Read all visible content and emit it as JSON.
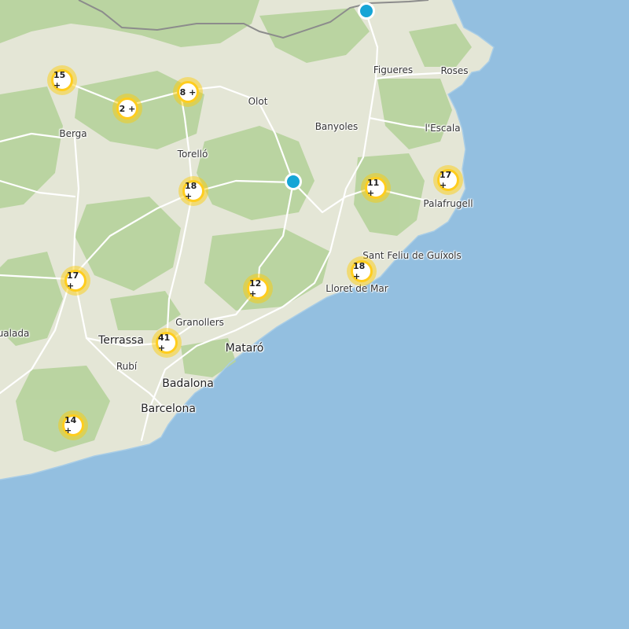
{
  "map": {
    "colors": {
      "sea": "#93bfe0",
      "land": "#e4e6d6",
      "forest": "#b6d39c",
      "road": "#ffffff",
      "border": "#8c8c8c",
      "cluster": "#ffcd1e",
      "marker": "#16a5d6"
    },
    "places": [
      {
        "id": "figueres",
        "name": "Figueres",
        "size": "med"
      },
      {
        "id": "roses",
        "name": "Roses",
        "size": "med"
      },
      {
        "id": "olot",
        "name": "Olot",
        "size": "med"
      },
      {
        "id": "banyoles",
        "name": "Banyoles",
        "size": "med"
      },
      {
        "id": "lescala",
        "name": "l'Escala",
        "size": "med"
      },
      {
        "id": "berga",
        "name": "Berga",
        "size": "med"
      },
      {
        "id": "torello",
        "name": "Torelló",
        "size": "med"
      },
      {
        "id": "palafrugell",
        "name": "Palafrugell",
        "size": "med"
      },
      {
        "id": "santfeliu",
        "name": "Sant Feliu de Guíxols",
        "size": "med"
      },
      {
        "id": "lloret",
        "name": "Lloret de Mar",
        "size": "med"
      },
      {
        "id": "igualada",
        "name": "ualada",
        "size": "med"
      },
      {
        "id": "granollers",
        "name": "Granollers",
        "size": "med"
      },
      {
        "id": "terrassa",
        "name": "Terrassa",
        "size": "big"
      },
      {
        "id": "mataro",
        "name": "Mataró",
        "size": "big"
      },
      {
        "id": "rubi",
        "name": "Rubí",
        "size": "med"
      },
      {
        "id": "badalona",
        "name": "Badalona",
        "size": "big"
      },
      {
        "id": "barcelona",
        "name": "Barcelona",
        "size": "big"
      }
    ],
    "clusters": [
      {
        "id": "c1",
        "label": "15 +"
      },
      {
        "id": "c2",
        "label": "2 +"
      },
      {
        "id": "c3",
        "label": "8 +"
      },
      {
        "id": "c4",
        "label": "18 +"
      },
      {
        "id": "c5",
        "label": "11 +"
      },
      {
        "id": "c6",
        "label": "17 +"
      },
      {
        "id": "c7",
        "label": "17 +"
      },
      {
        "id": "c8",
        "label": "12 +"
      },
      {
        "id": "c9",
        "label": "18 +"
      },
      {
        "id": "c10",
        "label": "41 +"
      },
      {
        "id": "c11",
        "label": "14 +"
      }
    ],
    "markers": [
      {
        "id": "m1",
        "icon": "location-marker"
      },
      {
        "id": "m2",
        "icon": "location-marker"
      }
    ]
  }
}
